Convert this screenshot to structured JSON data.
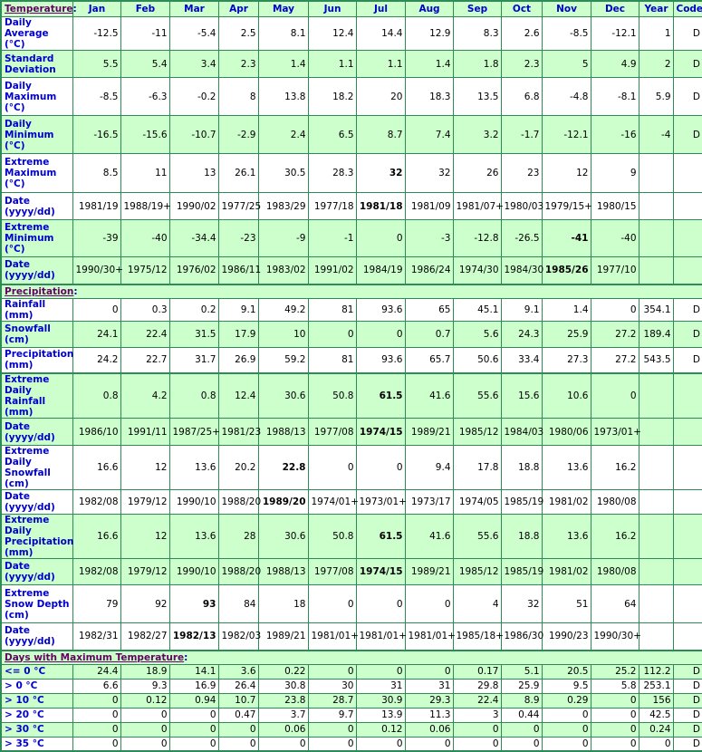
{
  "columns": [
    "Jan",
    "Feb",
    "Mar",
    "Apr",
    "May",
    "Jun",
    "Jul",
    "Aug",
    "Sep",
    "Oct",
    "Nov",
    "Dec",
    "Year",
    "Code"
  ],
  "sections": [
    {
      "title": "Temperature",
      "rows": [
        {
          "label": "Daily Average (°C)",
          "values": [
            "-12.5",
            "-11",
            "-5.4",
            "2.5",
            "8.1",
            "12.4",
            "14.4",
            "12.9",
            "8.3",
            "2.6",
            "-8.5",
            "-12.1",
            "1",
            "D"
          ],
          "bold": []
        },
        {
          "label": "Standard Deviation",
          "values": [
            "5.5",
            "5.4",
            "3.4",
            "2.3",
            "1.4",
            "1.1",
            "1.1",
            "1.4",
            "1.8",
            "2.3",
            "5",
            "4.9",
            "2",
            "D"
          ],
          "bold": []
        },
        {
          "label": "Daily Maximum (°C)",
          "values": [
            "-8.5",
            "-6.3",
            "-0.2",
            "8",
            "13.8",
            "18.2",
            "20",
            "18.3",
            "13.5",
            "6.8",
            "-4.8",
            "-8.1",
            "5.9",
            "D"
          ],
          "bold": []
        },
        {
          "label": "Daily Minimum (°C)",
          "values": [
            "-16.5",
            "-15.6",
            "-10.7",
            "-2.9",
            "2.4",
            "6.5",
            "8.7",
            "7.4",
            "3.2",
            "-1.7",
            "-12.1",
            "-16",
            "-4",
            "D"
          ],
          "bold": []
        },
        {
          "label": "Extreme Maximum (°C)",
          "values": [
            "8.5",
            "11",
            "13",
            "26.1",
            "30.5",
            "28.3",
            "32",
            "32",
            "26",
            "23",
            "12",
            "9",
            "",
            ""
          ],
          "bold": [
            6
          ]
        },
        {
          "label": "Date (yyyy/dd)",
          "values": [
            "1981/19",
            "1988/19+",
            "1990/02",
            "1977/25",
            "1983/29",
            "1977/18",
            "1981/18",
            "1981/09",
            "1981/07+",
            "1980/03",
            "1979/15+",
            "1980/15",
            "",
            ""
          ],
          "bold": [
            6
          ]
        },
        {
          "label": "Extreme Minimum (°C)",
          "values": [
            "-39",
            "-40",
            "-34.4",
            "-23",
            "-9",
            "-1",
            "0",
            "-3",
            "-12.8",
            "-26.5",
            "-41",
            "-40",
            "",
            ""
          ],
          "bold": [
            10
          ]
        },
        {
          "label": "Date (yyyy/dd)",
          "values": [
            "1990/30+",
            "1975/12",
            "1976/02",
            "1986/11",
            "1983/02",
            "1991/02",
            "1984/19",
            "1986/24",
            "1974/30",
            "1984/30",
            "1985/26",
            "1977/10",
            "",
            ""
          ],
          "bold": [
            10
          ]
        }
      ]
    },
    {
      "title": "Precipitation",
      "rows": [
        {
          "label": "Rainfall (mm)",
          "values": [
            "0",
            "0.3",
            "0.2",
            "9.1",
            "49.2",
            "81",
            "93.6",
            "65",
            "45.1",
            "9.1",
            "1.4",
            "0",
            "354.1",
            "D"
          ],
          "bold": []
        },
        {
          "label": "Snowfall (cm)",
          "values": [
            "24.1",
            "22.4",
            "31.5",
            "17.9",
            "10",
            "0",
            "0",
            "0.7",
            "5.6",
            "24.3",
            "25.9",
            "27.2",
            "189.4",
            "D"
          ],
          "bold": []
        },
        {
          "label": "Precipitation (mm)",
          "values": [
            "24.2",
            "22.7",
            "31.7",
            "26.9",
            "59.2",
            "81",
            "93.6",
            "65.7",
            "50.6",
            "33.4",
            "27.3",
            "27.2",
            "543.5",
            "D"
          ],
          "bold": []
        },
        {
          "label": "Extreme Daily Rainfall (mm)",
          "values": [
            "0.8",
            "4.2",
            "0.8",
            "12.4",
            "30.6",
            "50.8",
            "61.5",
            "41.6",
            "55.6",
            "15.6",
            "10.6",
            "0",
            "",
            ""
          ],
          "bold": [
            6
          ]
        },
        {
          "label": "Date (yyyy/dd)",
          "values": [
            "1986/10",
            "1991/11",
            "1987/25+",
            "1981/23",
            "1988/13",
            "1977/08",
            "1974/15",
            "1989/21",
            "1985/12",
            "1984/03",
            "1980/06",
            "1973/01+",
            "",
            ""
          ],
          "bold": [
            6
          ]
        },
        {
          "label": "Extreme Daily Snowfall (cm)",
          "values": [
            "16.6",
            "12",
            "13.6",
            "20.2",
            "22.8",
            "0",
            "0",
            "9.4",
            "17.8",
            "18.8",
            "13.6",
            "16.2",
            "",
            ""
          ],
          "bold": [
            4
          ]
        },
        {
          "label": "Date (yyyy/dd)",
          "values": [
            "1982/08",
            "1979/12",
            "1990/10",
            "1988/20",
            "1989/20",
            "1974/01+",
            "1973/01+",
            "1973/17",
            "1974/05",
            "1985/19",
            "1981/02",
            "1980/08",
            "",
            ""
          ],
          "bold": [
            4
          ]
        },
        {
          "label": "Extreme Daily Precipitation (mm)",
          "values": [
            "16.6",
            "12",
            "13.6",
            "28",
            "30.6",
            "50.8",
            "61.5",
            "41.6",
            "55.6",
            "18.8",
            "13.6",
            "16.2",
            "",
            ""
          ],
          "bold": [
            6
          ]
        },
        {
          "label": "Date (yyyy/dd)",
          "values": [
            "1982/08",
            "1979/12",
            "1990/10",
            "1988/20",
            "1988/13",
            "1977/08",
            "1974/15",
            "1989/21",
            "1985/12",
            "1985/19",
            "1981/02",
            "1980/08",
            "",
            ""
          ],
          "bold": [
            6
          ]
        },
        {
          "label": "Extreme Snow Depth (cm)",
          "values": [
            "79",
            "92",
            "93",
            "84",
            "18",
            "0",
            "0",
            "0",
            "4",
            "32",
            "51",
            "64",
            "",
            ""
          ],
          "bold": [
            2
          ]
        },
        {
          "label": "Date (yyyy/dd)",
          "values": [
            "1982/31",
            "1982/27",
            "1982/13",
            "1982/03",
            "1989/21",
            "1981/01+",
            "1981/01+",
            "1981/01+",
            "1985/18+",
            "1986/30",
            "1990/23",
            "1990/30+",
            "",
            ""
          ],
          "bold": [
            2
          ]
        }
      ]
    },
    {
      "title": "Days with Maximum Temperature",
      "rows": [
        {
          "label": "<= 0 °C",
          "values": [
            "24.4",
            "18.9",
            "14.1",
            "3.6",
            "0.22",
            "0",
            "0",
            "0",
            "0.17",
            "5.1",
            "20.5",
            "25.2",
            "112.2",
            "D"
          ],
          "bold": []
        },
        {
          "label": "> 0 °C",
          "values": [
            "6.6",
            "9.3",
            "16.9",
            "26.4",
            "30.8",
            "30",
            "31",
            "31",
            "29.8",
            "25.9",
            "9.5",
            "5.8",
            "253.1",
            "D"
          ],
          "bold": []
        },
        {
          "label": "> 10 °C",
          "values": [
            "0",
            "0.12",
            "0.94",
            "10.7",
            "23.8",
            "28.7",
            "30.9",
            "29.3",
            "22.4",
            "8.9",
            "0.29",
            "0",
            "156",
            "D"
          ],
          "bold": []
        },
        {
          "label": "> 20 °C",
          "values": [
            "0",
            "0",
            "0",
            "0.47",
            "3.7",
            "9.7",
            "13.9",
            "11.3",
            "3",
            "0.44",
            "0",
            "0",
            "42.5",
            "D"
          ],
          "bold": []
        },
        {
          "label": "> 30 °C",
          "values": [
            "0",
            "0",
            "0",
            "0",
            "0.06",
            "0",
            "0.12",
            "0.06",
            "0",
            "0",
            "0",
            "0",
            "0.24",
            "D"
          ],
          "bold": []
        },
        {
          "label": "> 35 °C",
          "values": [
            "0",
            "0",
            "0",
            "0",
            "0",
            "0",
            "0",
            "0",
            "0",
            "0",
            "0",
            "0",
            "0",
            "D"
          ],
          "bold": []
        }
      ]
    }
  ],
  "colors": {
    "border": "#2e8b57",
    "shade": "#ccffcc",
    "label_text": "#0000cc",
    "section_link": "#660066"
  }
}
